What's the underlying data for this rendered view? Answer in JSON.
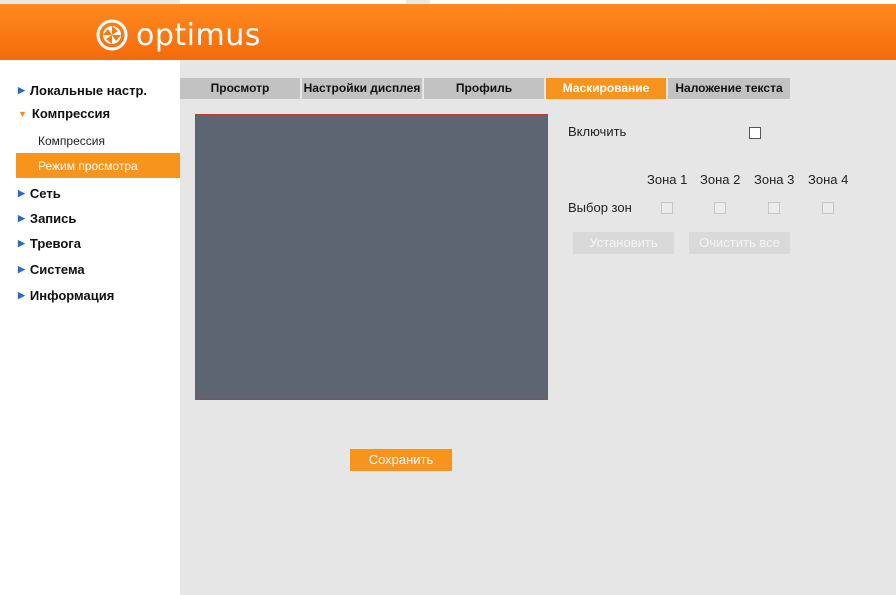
{
  "brand": {
    "name": "optimus",
    "color": "#f47a12"
  },
  "sidebar": {
    "items": [
      {
        "label": "Локальные настр.",
        "icon": "triangle-right-icon"
      },
      {
        "label": "Компрессия",
        "icon": "triangle-down-icon"
      },
      {
        "label": "Сеть",
        "icon": "triangle-right-icon"
      },
      {
        "label": "Запись",
        "icon": "triangle-right-icon"
      },
      {
        "label": "Тревога",
        "icon": "triangle-right-icon"
      },
      {
        "label": "Система",
        "icon": "triangle-right-icon"
      },
      {
        "label": "Информация",
        "icon": "triangle-right-icon"
      }
    ],
    "subitems": [
      {
        "label": "Компрессия",
        "active": false
      },
      {
        "label": "Режим просмотра",
        "active": true
      }
    ]
  },
  "tabs": [
    {
      "label": "Просмотр",
      "active": false
    },
    {
      "label": "Настройки дисплея",
      "active": false
    },
    {
      "label": "Профиль",
      "active": false
    },
    {
      "label": "Маскирование",
      "active": true
    },
    {
      "label": "Наложение текста",
      "active": false
    }
  ],
  "mask": {
    "enable_label": "Включить",
    "zones": [
      "Зона 1",
      "Зона 2",
      "Зона 3",
      "Зона 4"
    ],
    "zone_select_label": "Выбор зон",
    "set_button": "Установить",
    "clear_button": "Очистить все"
  },
  "save_button": "Сохранить",
  "colors": {
    "accent": "#f7941d",
    "preview": "#5d6472",
    "preview_border": "#c0383a"
  }
}
